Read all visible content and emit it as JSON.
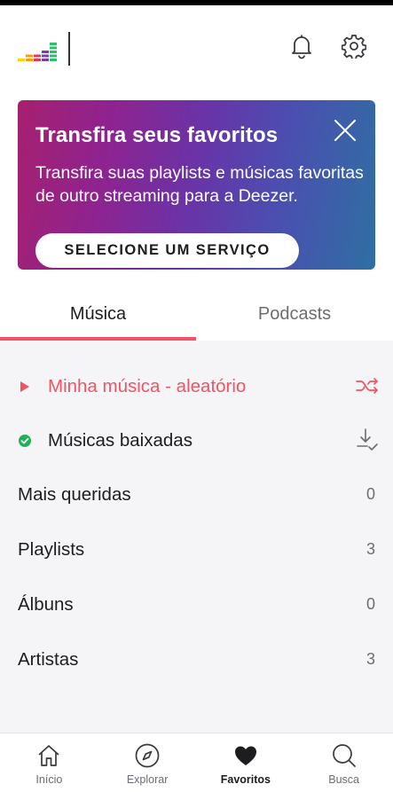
{
  "colors": {
    "accent": "#ef5466",
    "success": "#1fb15a",
    "text_primary": "#1d1d1f",
    "text_secondary": "#6c6c73",
    "list_background": "#f5f5f7"
  },
  "header": {
    "logo_icon": "deezer-logo-icon",
    "notifications_icon": "bell-icon",
    "settings_icon": "gear-icon"
  },
  "banner": {
    "title": "Transfira seus favoritos",
    "text": "Transfira suas playlists e músicas favoritas de outro streaming para a Deezer.",
    "cta_label": "SELECIONE UM SERVIÇO",
    "close_icon": "close-icon"
  },
  "tabs": [
    {
      "label": "Música",
      "active": true
    },
    {
      "label": "Podcasts",
      "active": false
    }
  ],
  "list": {
    "shuffle": {
      "label": "Minha música - aleatório",
      "left_icon": "play-icon",
      "right_icon": "shuffle-icon"
    },
    "downloads": {
      "label": "Músicas baixadas",
      "left_icon": "check-circle-icon",
      "right_icon": "download-icon"
    },
    "items": [
      {
        "label": "Mais queridas",
        "count": "0"
      },
      {
        "label": "Playlists",
        "count": "3"
      },
      {
        "label": "Álbuns",
        "count": "0"
      },
      {
        "label": "Artistas",
        "count": "3"
      }
    ]
  },
  "bottom_nav": [
    {
      "label": "Início",
      "icon": "home-icon",
      "active": false
    },
    {
      "label": "Explorar",
      "icon": "compass-icon",
      "active": false
    },
    {
      "label": "Favoritos",
      "icon": "heart-icon",
      "active": true
    },
    {
      "label": "Busca",
      "icon": "search-icon",
      "active": false
    }
  ]
}
